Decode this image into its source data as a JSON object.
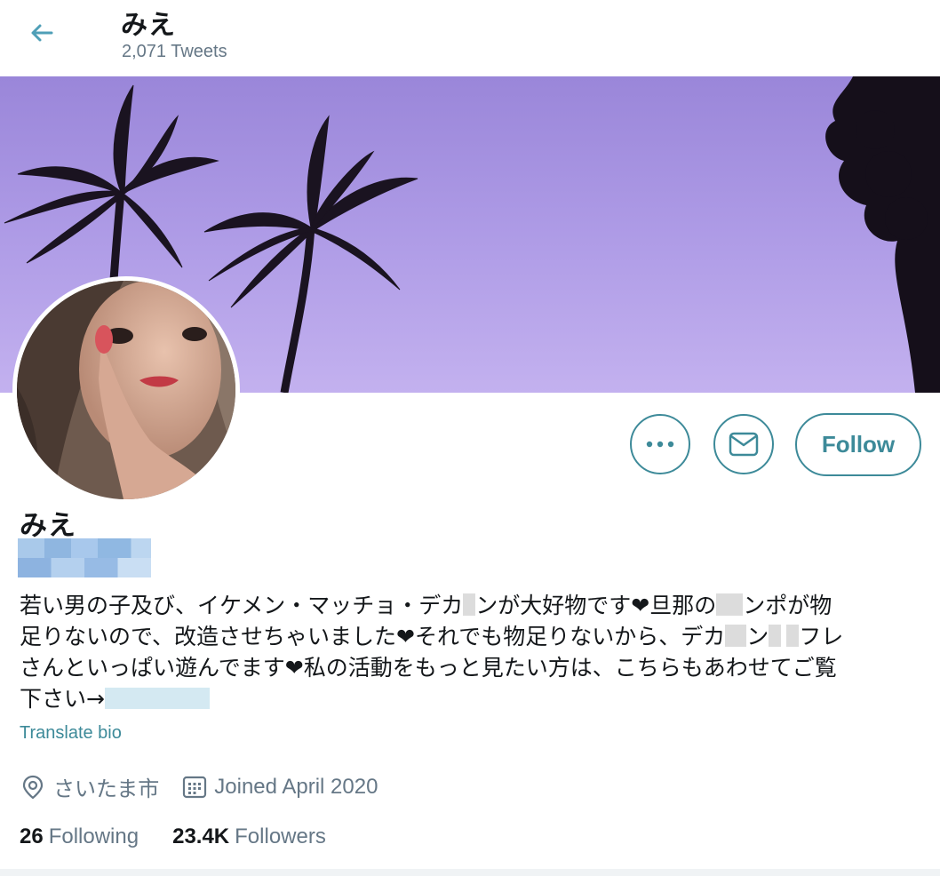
{
  "header": {
    "name": "みえ",
    "tweet_count": "2,071 Tweets",
    "back_icon": "arrow-left-icon"
  },
  "profile": {
    "display_name": "みえ",
    "bio_lines": [
      [
        "若い男の子及び、イケメン・マッチョ・デカ",
        "ンが大好物です❤旦那の",
        "ンポが物"
      ],
      [
        "足りないので、改造させちゃいました❤それでも物足りないから、デカ",
        "ン",
        "フレ"
      ],
      [
        "さんといっぱい遊んでます❤私の活動をもっと見たい方は、こちらもあわせてご覧"
      ],
      [
        "下さい→"
      ]
    ],
    "translate_label": "Translate bio",
    "location": "さいたま市",
    "joined": "Joined April 2020",
    "following_count": "26",
    "following_label": "Following",
    "followers_count": "23.4K",
    "followers_label": "Followers"
  },
  "actions": {
    "more_icon": "more-icon",
    "message_icon": "envelope-icon",
    "follow_label": "Follow"
  },
  "colors": {
    "accent": "#3d8a99",
    "secondary_text": "#657786",
    "banner_sky": "#b29ce6"
  }
}
